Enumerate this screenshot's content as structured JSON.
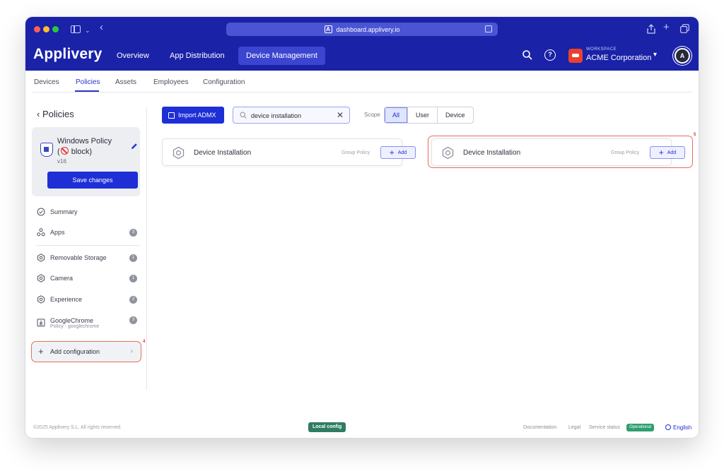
{
  "browser": {
    "url": "dashboard.applivery.io"
  },
  "header": {
    "brand": "Applivery",
    "nav": [
      "Overview",
      "App Distribution",
      "Device Management"
    ],
    "active_nav": "Device Management",
    "workspace_caption": "WORKSPACE",
    "workspace_name": "ACME Corporation",
    "avatar_text": "A"
  },
  "tabs": {
    "items": [
      "Devices",
      "Policies",
      "Assets",
      "Employees",
      "Configuration"
    ],
    "active": "Policies"
  },
  "sidebar": {
    "back_label": "Policies",
    "policy": {
      "title_line1": "Windows Policy",
      "title_line2_prefix": "(",
      "title_line2_suffix": " block)",
      "version": "v16",
      "save_label": "Save changes"
    },
    "items": [
      {
        "label": "Summary",
        "icon": "check-circle-icon"
      },
      {
        "label": "Apps",
        "badge": "3",
        "icon": "apps-icon"
      },
      {
        "label": "Removable Storage",
        "badge": "1",
        "icon": "gear-icon"
      },
      {
        "label": "Camera",
        "badge": "1",
        "icon": "gear-icon"
      },
      {
        "label": "Experience",
        "badge": "2",
        "icon": "gear-icon"
      },
      {
        "label": "GoogleChrome",
        "sublabel": "Policy - googlechrome",
        "badge": "3",
        "icon": "download-box-icon"
      }
    ],
    "add_configuration": "Add configuration",
    "callout_4": "4"
  },
  "toolbar": {
    "import_label": "Import ADMX",
    "search_value": "device installation",
    "scope_label": "Scope",
    "scope_options": [
      "All",
      "User",
      "Device"
    ],
    "scope_selected": "All"
  },
  "results": [
    {
      "title": "Device Installation",
      "type": "Group Policy",
      "add_label": "Add"
    },
    {
      "title": "Device Installation",
      "type": "Group Policy",
      "add_label": "Add"
    }
  ],
  "callout_5": "5",
  "footer": {
    "copyright": "©2025 Applivery S.L. All rights reserved.",
    "local_config": "Local config",
    "links": [
      "Documentation",
      "Legal",
      "Service status"
    ],
    "status": "Operational",
    "language": "English"
  },
  "colors": {
    "brand": "#1a22a8",
    "primary": "#1e2fd6",
    "callout": "#e86d5d",
    "status_ok": "#2e9e6f"
  }
}
